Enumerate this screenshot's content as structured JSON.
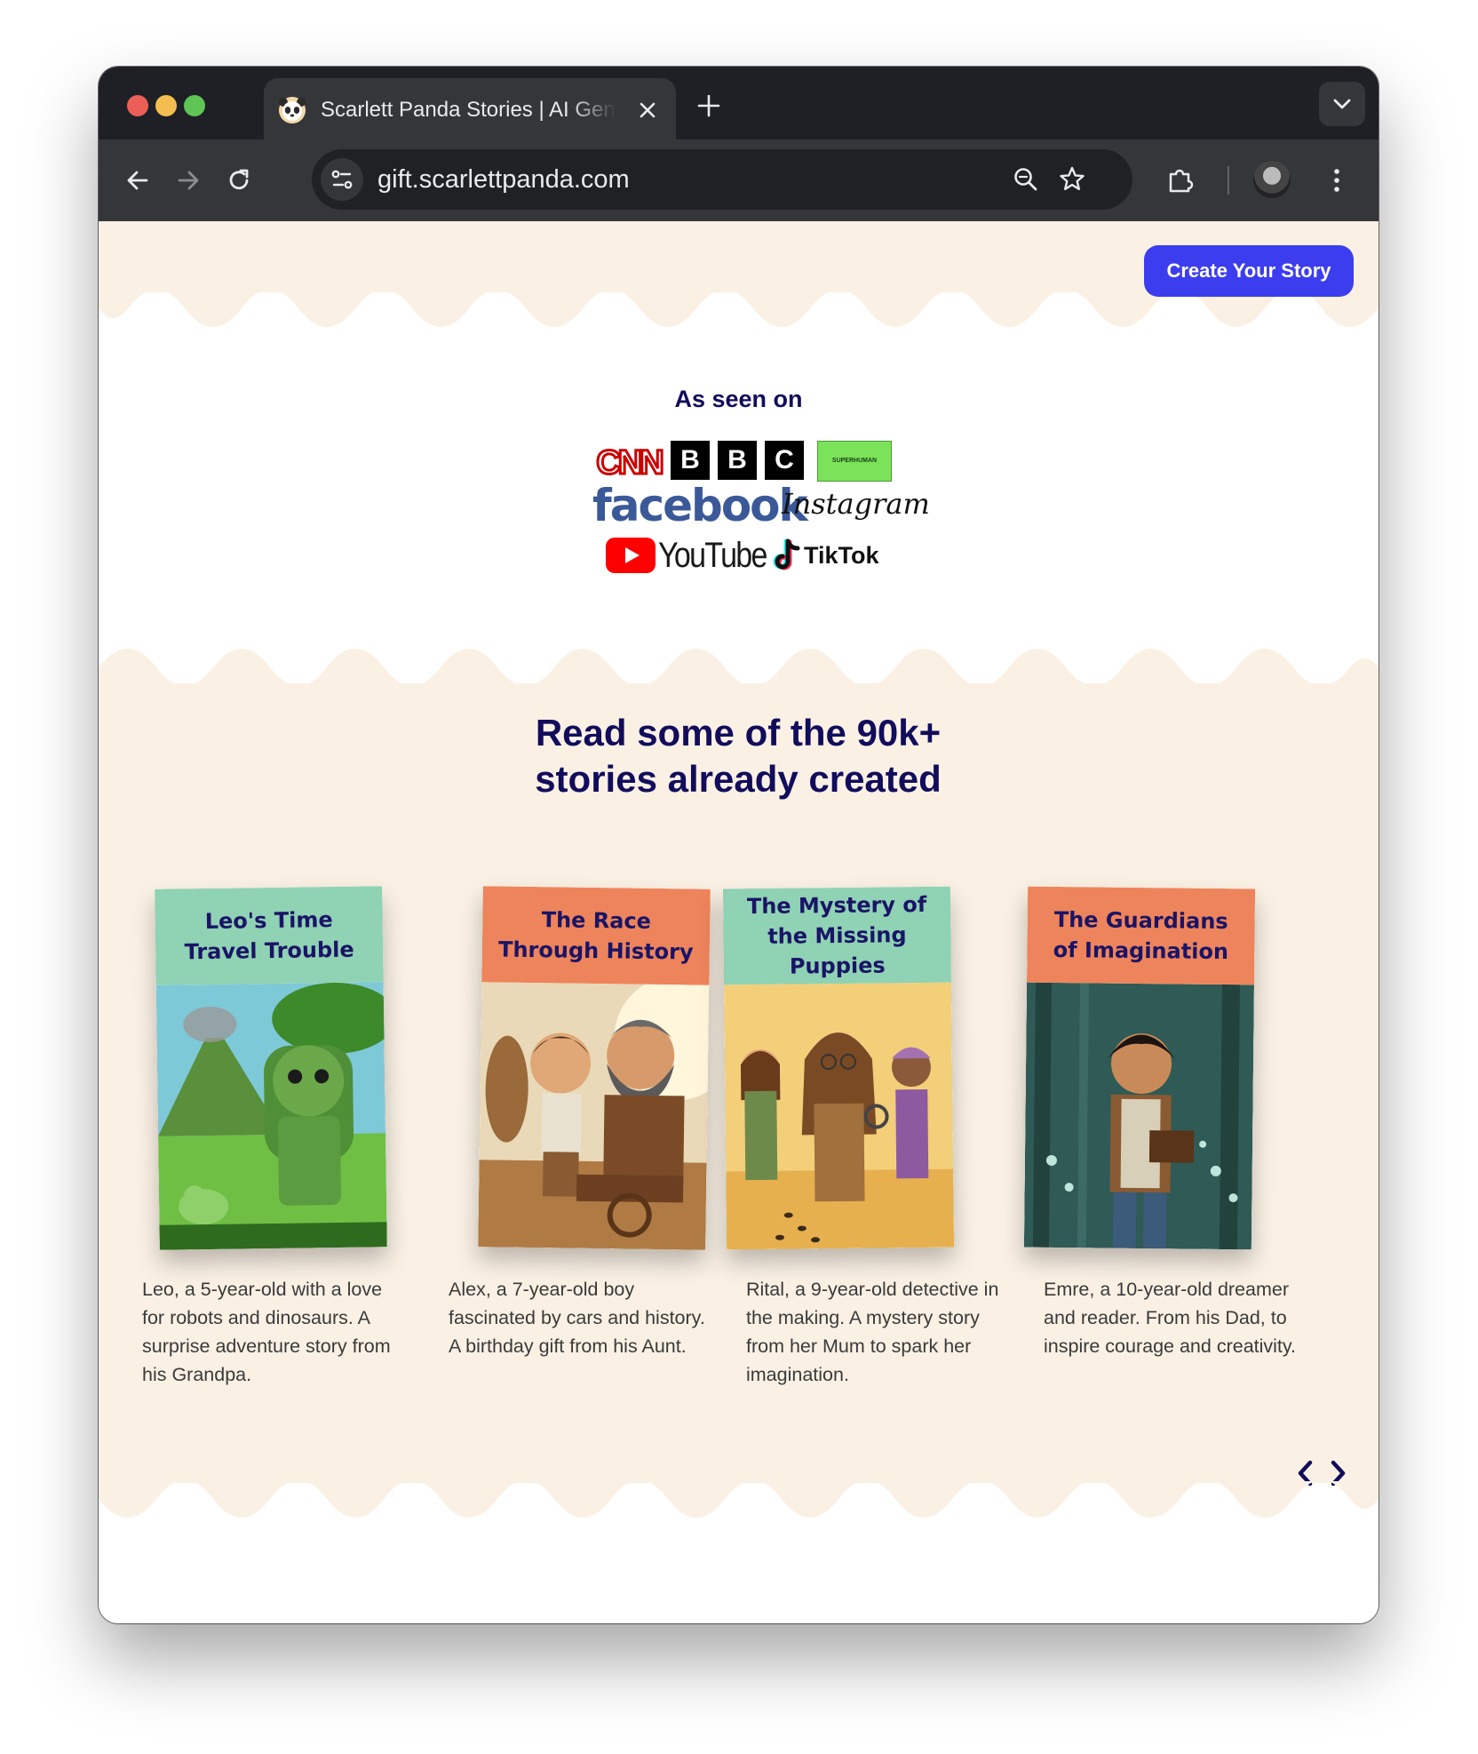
{
  "browser": {
    "tab_title": "Scarlett Panda Stories | AI Generated",
    "url": "gift.scarlettpanda.com"
  },
  "header": {
    "cta_label": "Create Your Story"
  },
  "as_seen_on": {
    "title": "As seen on",
    "logos": {
      "cnn": "CNN",
      "bbc_1": "B",
      "bbc_2": "B",
      "bbc_3": "C",
      "green": "SUPERHUMAN",
      "facebook": "facebook",
      "instagram": "Instagram",
      "youtube": "YouTube",
      "tiktok": "TikTok"
    }
  },
  "stories": {
    "title_line1": "Read some of the 90k+",
    "title_line2": "stories already created",
    "books": [
      {
        "title": "Leo's Time Travel Trouble",
        "description": "Leo, a 5-year-old with a love for robots and dinosaurs. A surprise adventure story from his Grandpa.",
        "header_color": "#8fd2b4"
      },
      {
        "title": "The Race Through History",
        "description": "Alex, a 7-year-old boy fascinated by cars and history. A birthday gift from his Aunt.",
        "header_color": "#ee845b"
      },
      {
        "title": "The Mystery of the Missing Puppies",
        "description": "Rital, a 9-year-old detective in the making. A mystery story from her Mum to spark her imagination.",
        "header_color": "#8fd2b4"
      },
      {
        "title": "The Guardians of Imagination",
        "description": "Emre, a 10-year-old dreamer and reader. From his Dad, to inspire courage and creativity.",
        "header_color": "#ee845b"
      }
    ]
  },
  "colors": {
    "accent": "#3d3df0",
    "heading": "#120c5c",
    "cream": "#faf1e4"
  }
}
